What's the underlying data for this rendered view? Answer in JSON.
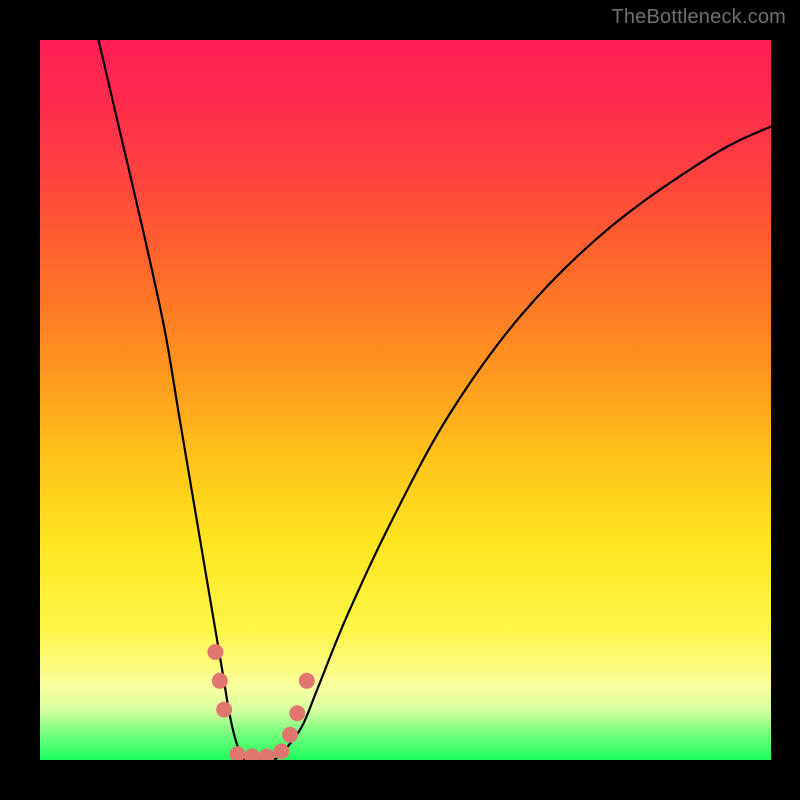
{
  "watermark": "TheBottleneck.com",
  "chart_data": {
    "type": "line",
    "title": "",
    "xlabel": "",
    "ylabel": "",
    "xlim": [
      0,
      100
    ],
    "ylim": [
      0,
      100
    ],
    "series": [
      {
        "name": "bottleneck-curve",
        "x": [
          8,
          11,
          14,
          17,
          19,
          21,
          23,
          25,
          26,
          27,
          28,
          30,
          32,
          34,
          36,
          38,
          42,
          48,
          56,
          66,
          78,
          92,
          100
        ],
        "y": [
          100,
          87,
          74,
          60,
          48,
          36,
          24,
          12,
          6,
          2,
          0,
          0,
          0,
          2,
          5,
          10,
          20,
          33,
          48,
          62,
          74,
          84,
          88
        ]
      }
    ],
    "markers": {
      "name": "highlight-dots",
      "color": "#e0776f",
      "points": [
        {
          "x": 24.0,
          "y": 15
        },
        {
          "x": 24.6,
          "y": 11
        },
        {
          "x": 25.2,
          "y": 7
        },
        {
          "x": 27.0,
          "y": 0.8
        },
        {
          "x": 29.0,
          "y": 0.5
        },
        {
          "x": 31.0,
          "y": 0.5
        },
        {
          "x": 33.0,
          "y": 1.2
        },
        {
          "x": 34.2,
          "y": 3.5
        },
        {
          "x": 35.2,
          "y": 6.5
        },
        {
          "x": 36.5,
          "y": 11
        }
      ]
    }
  }
}
